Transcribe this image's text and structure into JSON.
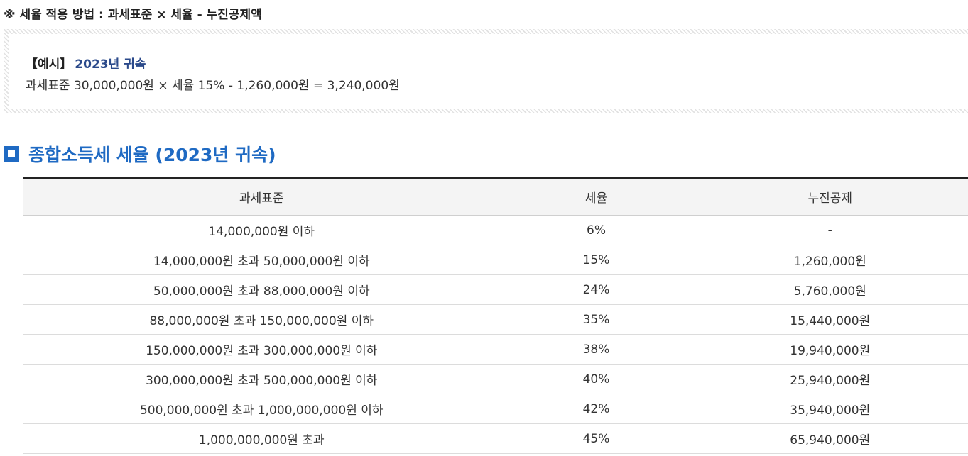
{
  "method": {
    "title": "※ 세율 적용 방법 : 과세표준 × 세율 - 누진공제액"
  },
  "example": {
    "bracket_label": "【예시】",
    "year_label": "2023년 귀속",
    "formula": "과세표준 30,000,000원 × 세율 15% - 1,260,000원 = 3,240,000원"
  },
  "section": {
    "title": "종합소득세 세율 (2023년 귀속)",
    "icon": "square-bullet-icon",
    "accent_color": "#1f6ac3"
  },
  "table": {
    "headers": [
      "과세표준",
      "세율",
      "누진공제"
    ],
    "rows": [
      [
        "14,000,000원 이하",
        "6%",
        "-"
      ],
      [
        "14,000,000원 초과 50,000,000원 이하",
        "15%",
        "1,260,000원"
      ],
      [
        "50,000,000원 초과 88,000,000원 이하",
        "24%",
        "5,760,000원"
      ],
      [
        "88,000,000원 초과 150,000,000원 이하",
        "35%",
        "15,440,000원"
      ],
      [
        "150,000,000원 초과 300,000,000원 이하",
        "38%",
        "19,940,000원"
      ],
      [
        "300,000,000원 초과 500,000,000원 이하",
        "40%",
        "25,940,000원"
      ],
      [
        "500,000,000원 초과 1,000,000,000원 이하",
        "42%",
        "35,940,000원"
      ],
      [
        "1,000,000,000원 초과",
        "45%",
        "65,940,000원"
      ]
    ]
  }
}
